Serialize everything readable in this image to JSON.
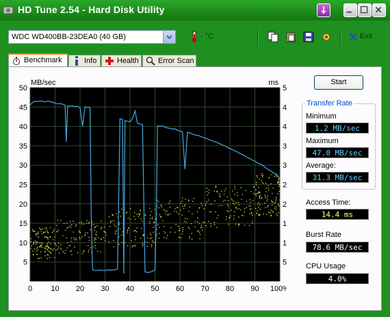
{
  "window": {
    "title": "HD Tune 2.54 - Hard Disk Utility"
  },
  "toolbar": {
    "drive": "WDC WD400BB-23DEA0 (40 GB)",
    "temperature": "- °C",
    "exit_label": "Exit"
  },
  "tabs": [
    {
      "label": "Benchmark"
    },
    {
      "label": "Info"
    },
    {
      "label": "Health"
    },
    {
      "label": "Error Scan"
    }
  ],
  "controls": {
    "start_label": "Start"
  },
  "results": {
    "group_title": "Transfer Rate",
    "minimum_label": "Minimum",
    "minimum_value": "1.2 MB/sec",
    "maximum_label": "Maximum",
    "maximum_value": "47.0 MB/sec",
    "average_label": "Average:",
    "average_value": "31.3 MB/sec",
    "access_label": "Access Time:",
    "access_value": "14.4 ms",
    "burst_label": "Burst Rate",
    "burst_value": "78.6 MB/sec",
    "cpu_label": "CPU Usage",
    "cpu_value": "4.0%"
  },
  "chart_data": {
    "type": "line",
    "left_unit": "MB/sec",
    "right_unit": "ms",
    "ylim": [
      0,
      50
    ],
    "y_ticks": [
      5,
      10,
      15,
      20,
      25,
      30,
      35,
      40,
      45,
      50
    ],
    "x_ticks": [
      "0",
      "10",
      "20",
      "30",
      "40",
      "50",
      "60",
      "70",
      "80",
      "90",
      "100%"
    ],
    "grid": true,
    "colors": {
      "background": "#000000",
      "transfer": "#4aa8e0",
      "access": "#e8e84a",
      "grid": "#2e4a2e"
    },
    "series": [
      {
        "x": [
          0,
          1,
          2,
          3,
          4,
          5,
          6,
          7,
          8,
          9,
          10,
          11,
          12,
          13,
          14,
          14.5,
          15,
          16,
          17,
          18,
          19,
          20,
          21,
          22,
          23,
          24,
          24.5,
          25,
          26,
          28,
          30,
          31,
          32,
          34,
          35,
          36,
          37,
          37.5,
          38,
          39,
          40,
          41,
          42,
          43,
          44,
          45,
          46,
          47,
          48,
          49,
          50,
          50.5,
          51,
          52,
          53,
          54,
          55,
          56,
          57,
          58,
          59,
          60,
          61,
          62,
          63,
          64,
          65,
          66,
          67,
          68,
          69,
          70,
          71,
          72,
          73,
          74,
          75,
          76,
          77,
          78,
          79,
          80,
          81,
          82,
          83,
          84,
          85,
          86,
          87,
          88,
          89,
          90,
          91,
          92,
          93,
          94,
          95,
          96,
          97,
          98,
          99,
          100
        ],
        "y": [
          45.5,
          46.2,
          46.5,
          46.4,
          46.6,
          46.5,
          46.3,
          46.5,
          46.4,
          46.2,
          46.0,
          45.8,
          45.9,
          45.7,
          45.5,
          36.0,
          45.3,
          45.2,
          45.3,
          45.1,
          45.2,
          44.8,
          40.0,
          45.0,
          44.9,
          44.8,
          16.0,
          3.0,
          2.8,
          2.9,
          2.8,
          3.0,
          2.9,
          3.0,
          3.2,
          42.0,
          41.8,
          2.0,
          41.5,
          41.3,
          41.2,
          42.0,
          44.0,
          40.8,
          40.6,
          40.5,
          2.5,
          2.3,
          2.4,
          2.6,
          3.0,
          15.0,
          40.2,
          40.0,
          40.1,
          39.8,
          39.6,
          39.5,
          39.3,
          39.4,
          39.0,
          38.8,
          38.6,
          29.0,
          38.5,
          38.3,
          38.0,
          37.8,
          37.7,
          37.5,
          37.2,
          37.0,
          36.8,
          36.5,
          36.3,
          36.0,
          35.8,
          35.5,
          35.2,
          35.0,
          34.6,
          34.3,
          34.0,
          33.7,
          33.4,
          33.0,
          32.7,
          32.4,
          32.0,
          31.7,
          31.3,
          31.0,
          30.6,
          30.3,
          30.0,
          29.5,
          29.0,
          28.6,
          28.2,
          27.8,
          27.4,
          26.5
        ]
      }
    ],
    "access_cloud": [
      {
        "x_from": 0,
        "x_to": 10,
        "y_from": 6,
        "y_to": 14
      },
      {
        "x_from": 10,
        "x_to": 30,
        "y_from": 7,
        "y_to": 16
      },
      {
        "x_from": 30,
        "x_to": 50,
        "y_from": 9,
        "y_to": 19
      },
      {
        "x_from": 50,
        "x_to": 70,
        "y_from": 11,
        "y_to": 22
      },
      {
        "x_from": 70,
        "x_to": 90,
        "y_from": 14,
        "y_to": 25
      },
      {
        "x_from": 90,
        "x_to": 100,
        "y_from": 17,
        "y_to": 28
      }
    ]
  }
}
